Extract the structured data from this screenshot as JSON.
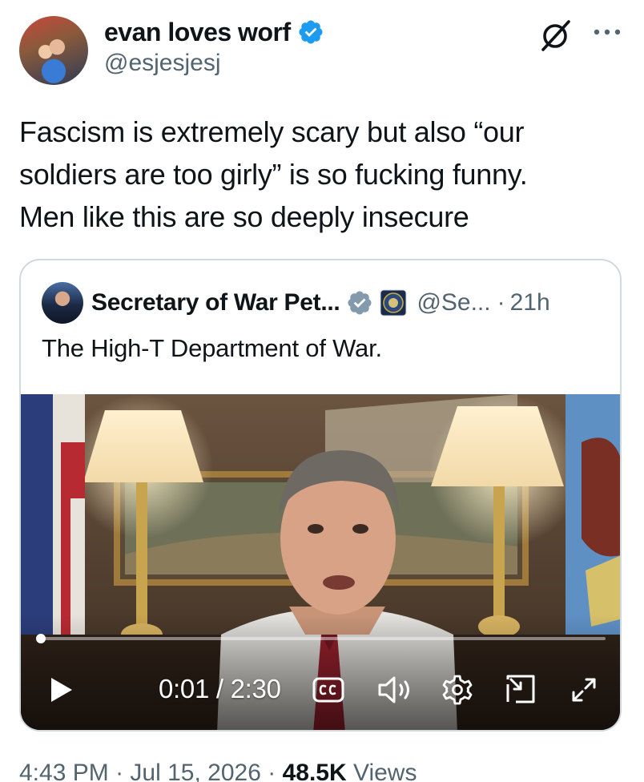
{
  "author": {
    "display_name": "evan loves worf",
    "handle": "@esjesjesj",
    "verified_color": "#1d9bf0"
  },
  "tweet": {
    "lines": [
      "Fascism is extremely scary but also “our",
      "soldiers are too girly” is so fucking funny.",
      "Men like this are so deeply insecure"
    ]
  },
  "quote": {
    "display_name": "Secretary of War Pet...",
    "handle": "@Se...",
    "separator": "·",
    "time": "21h",
    "text": "The High-T Department of War.",
    "verified_color": "#829aab"
  },
  "video": {
    "time_readout": "0:01 / 2:30",
    "progress_fraction": 0.007,
    "controls": [
      "play-icon",
      "closed-captions-icon",
      "volume-icon",
      "settings-gear-icon",
      "picture-in-picture-icon",
      "fullscreen-icon"
    ]
  },
  "meta": {
    "time": "4:43 PM",
    "sep1": "·",
    "date": "Jul 15, 2026",
    "sep2": "·",
    "views_count": "48.5K",
    "views_label": "Views"
  },
  "icons": {
    "header_right": [
      "grok-icon",
      "more-icon"
    ]
  }
}
